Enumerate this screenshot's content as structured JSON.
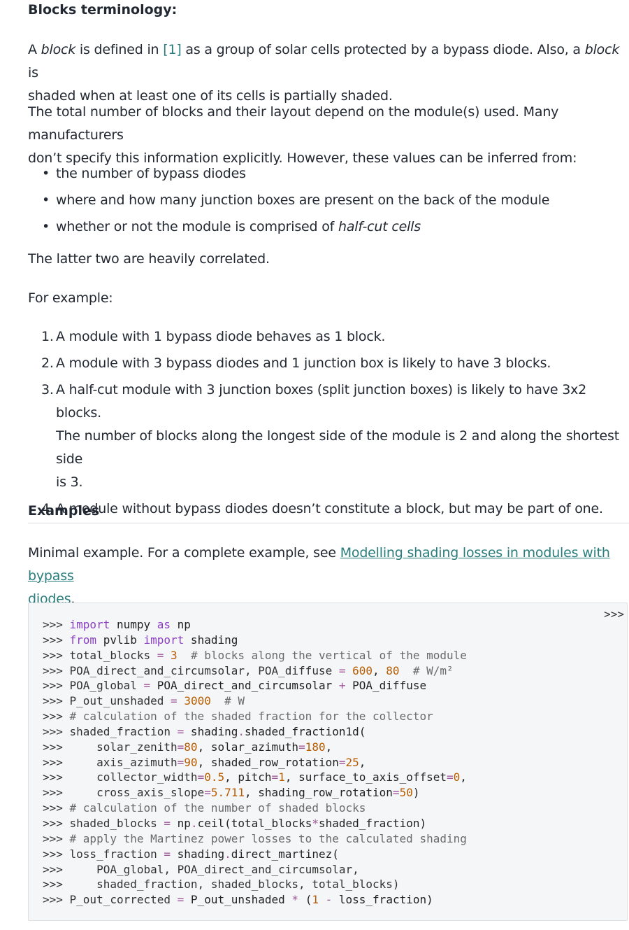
{
  "section1": {
    "heading": "Blocks terminology:",
    "para1": {
      "t1": "A ",
      "em1": "block",
      "t2": " is defined in ",
      "link": "[1]",
      "t3": " as a group of solar cells protected by a bypass diode. Also, a ",
      "em2": "block",
      "t4": " is",
      "line2": "shaded when at least one of its cells is partially shaded."
    },
    "para2": {
      "line1": "The total number of blocks and their layout depend on the module(s) used. Many manufacturers",
      "line2": "don’t specify this information explicitly. However, these values can be inferred from:"
    },
    "bullets": [
      "the number of bypass diodes",
      "where and how many junction boxes are present on the back of the module"
    ],
    "bullet3": {
      "text": "whether or not the module is comprised of ",
      "em": "half-cut cells"
    },
    "para3": "The latter two are heavily correlated.",
    "para4": "For example:",
    "numbered": [
      {
        "num": "1.",
        "line1": "A module with 1 bypass diode behaves as 1 block."
      },
      {
        "num": "2.",
        "line1": "A module with 3 bypass diodes and 1 junction box is likely to have 3 blocks."
      },
      {
        "num": "3.",
        "line1": "A half-cut module with 3 junction boxes (split junction boxes) is likely to have 3x2 blocks.",
        "line2": "The number of blocks along the longest side of the module is 2 and along the shortest side",
        "line3": "is 3."
      },
      {
        "num": "4.",
        "line1": "A module without bypass diodes doesn’t constitute a block, but may be part of one."
      }
    ]
  },
  "examples": {
    "heading": "Examples",
    "intro_text": "Minimal example. For a complete example, see ",
    "link_line1": "Modelling shading losses in modules with bypass",
    "link_line2": "diodes",
    "period": "."
  },
  "code": {
    "copy_label": ">>>",
    "lines": [
      [
        ">>> ",
        "import",
        " numpy ",
        "as",
        " np"
      ],
      [
        ">>> ",
        "from",
        " pvlib ",
        "import",
        " shading"
      ],
      [
        ">>> total_blocks ",
        "=",
        " ",
        "3",
        "  ",
        "# blocks along the vertical of the module"
      ],
      [
        ">>> POA_direct_and_circumsolar, POA_diffuse ",
        "=",
        " ",
        "600",
        ", ",
        "80",
        "  ",
        "# W/m²"
      ],
      [
        ">>> POA_global ",
        "=",
        " POA_direct_and_circumsolar ",
        "+",
        " POA_diffuse"
      ],
      [
        ">>> P_out_unshaded ",
        "=",
        " ",
        "3000",
        "  ",
        "# W"
      ],
      [
        ">>> ",
        "# calculation of the shaded fraction for the collector"
      ],
      [
        ">>> shaded_fraction ",
        "=",
        " shading",
        ".",
        "shaded_fraction1d("
      ],
      [
        ">>>     solar_zenith",
        "=",
        "80",
        ", solar_azimuth",
        "=",
        "180",
        ","
      ],
      [
        ">>>     axis_azimuth",
        "=",
        "90",
        ", shaded_row_rotation",
        "=",
        "25",
        ","
      ],
      [
        ">>>     collector_width",
        "=",
        "0.5",
        ", pitch",
        "=",
        "1",
        ", surface_to_axis_offset",
        "=",
        "0",
        ","
      ],
      [
        ">>>     cross_axis_slope",
        "=",
        "5.711",
        ", shading_row_rotation",
        "=",
        "50",
        ")"
      ],
      [
        ">>> ",
        "# calculation of the number of shaded blocks"
      ],
      [
        ">>> shaded_blocks ",
        "=",
        " np",
        ".",
        "ceil(total_blocks",
        "*",
        "shaded_fraction)"
      ],
      [
        ">>> ",
        "# apply the Martinez power losses to the calculated shading"
      ],
      [
        ">>> loss_fraction ",
        "=",
        " shading",
        ".",
        "direct_martinez("
      ],
      [
        ">>>     POA_global, POA_direct_and_circumsolar,"
      ],
      [
        ">>>     shaded_fraction, shaded_blocks, total_blocks)"
      ],
      [
        ">>> P_out_corrected ",
        "=",
        " P_out_unshaded ",
        "*",
        " (",
        "1",
        " ",
        "-",
        " loss_fraction)"
      ]
    ]
  }
}
